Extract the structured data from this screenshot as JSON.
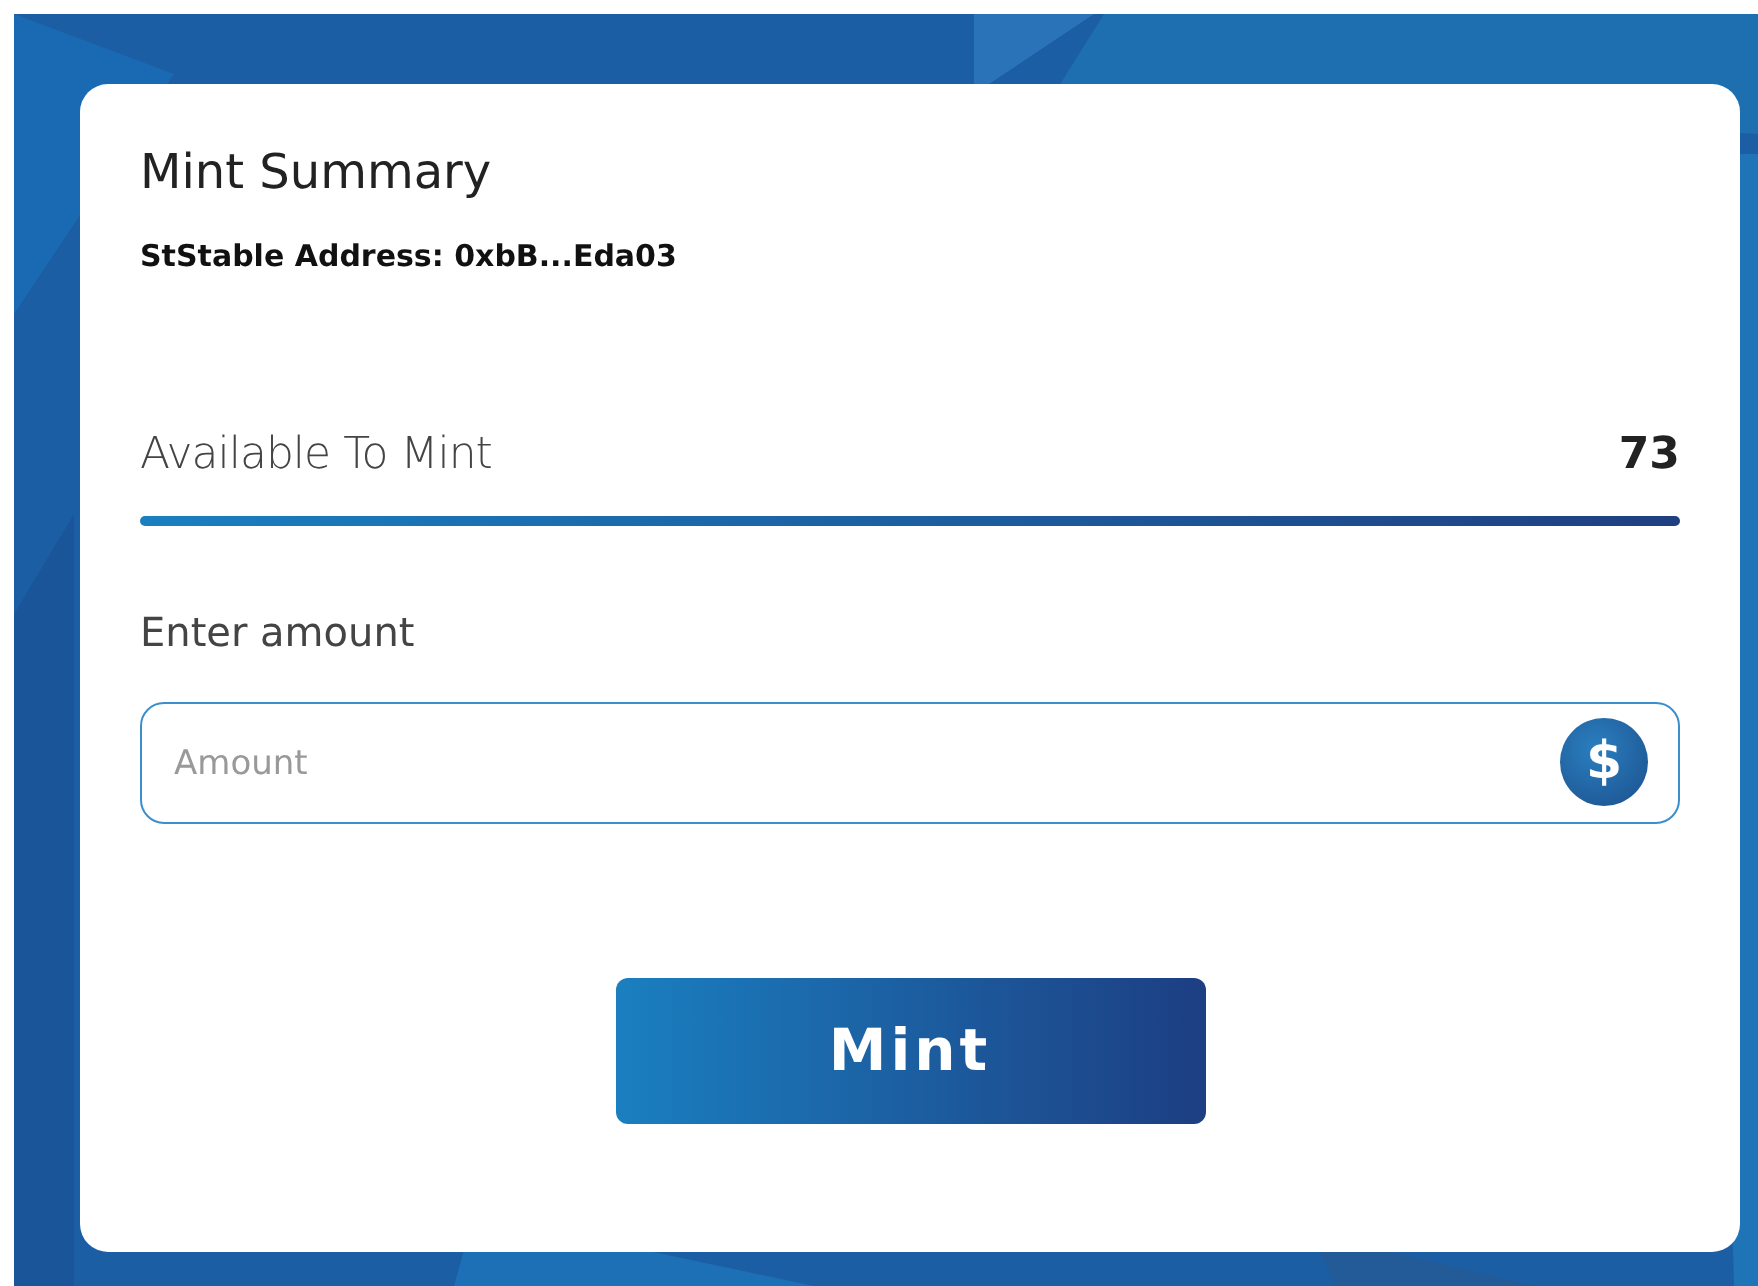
{
  "card": {
    "title": "Mint Summary",
    "address": "StStable Address: 0xbB...Eda03"
  },
  "available": {
    "label": "Available To Mint",
    "value": "73"
  },
  "amount_field": {
    "label": "Enter amount",
    "placeholder": "Amount",
    "icon": "$"
  },
  "buttons": [
    "Mint"
  ]
}
